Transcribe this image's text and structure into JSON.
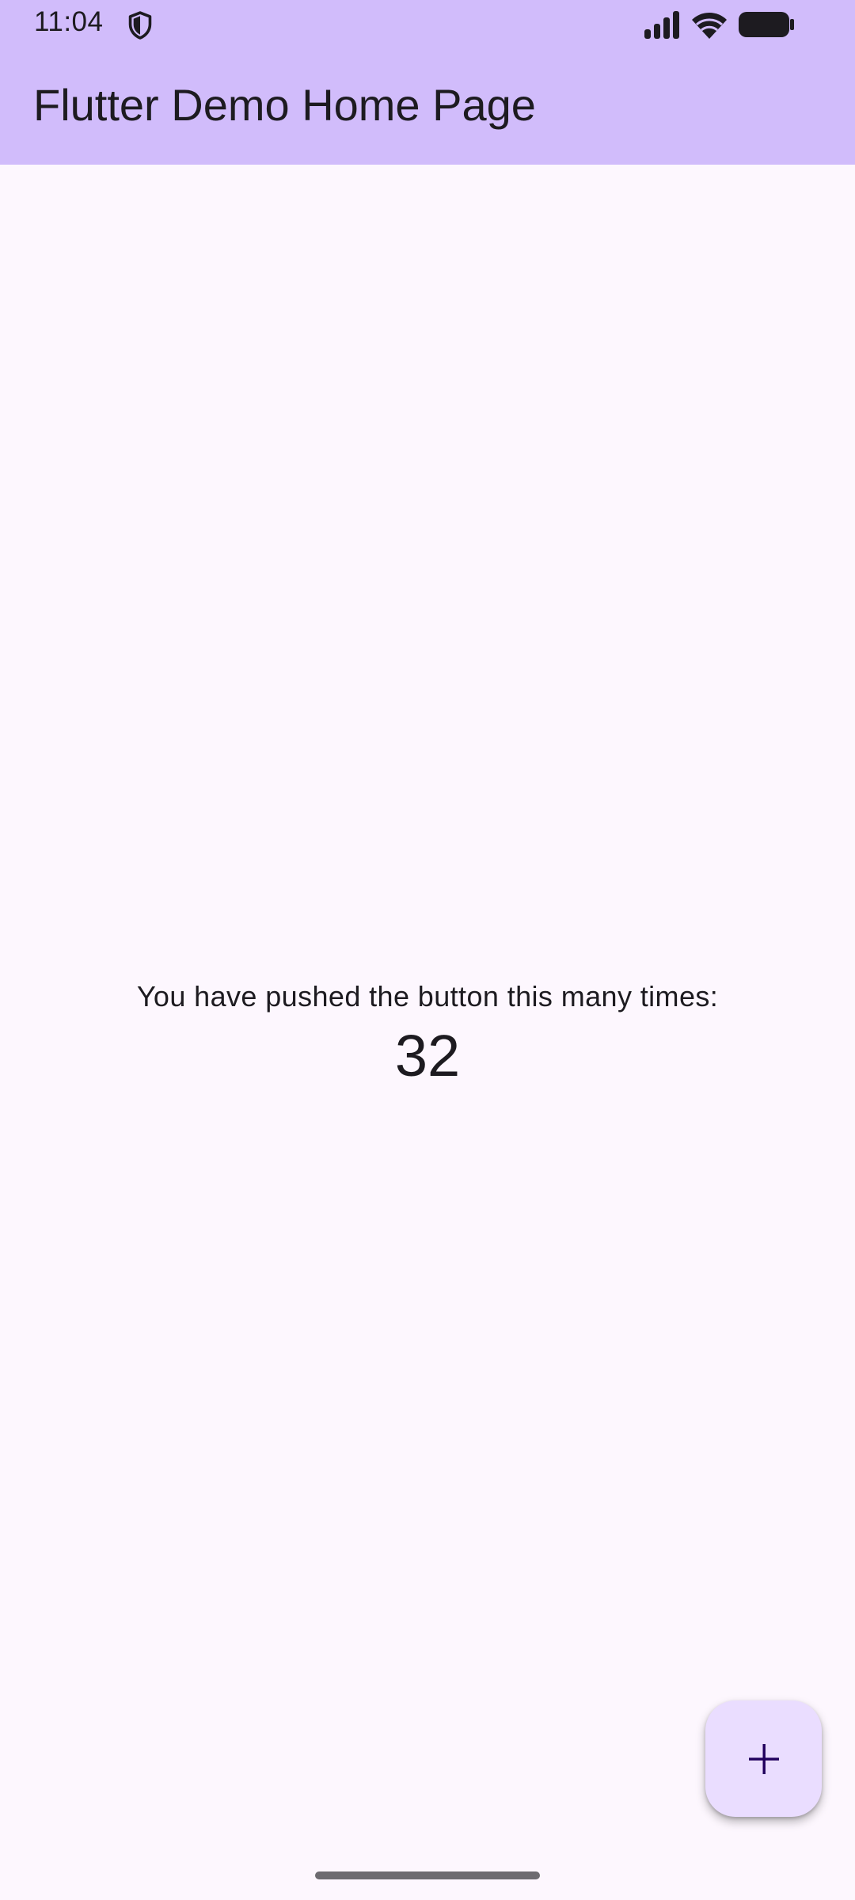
{
  "status_bar": {
    "time": "11:04",
    "icons": [
      "shield-icon",
      "signal-icon",
      "wifi-icon",
      "battery-icon"
    ]
  },
  "app_bar": {
    "title": "Flutter Demo Home Page",
    "background_color": "#d1bcfb"
  },
  "body": {
    "label": "You have pushed the button this many times:",
    "counter": "32",
    "background_color": "#fdf7fe"
  },
  "fab": {
    "icon": "add-icon",
    "background_color": "#eaddff"
  }
}
